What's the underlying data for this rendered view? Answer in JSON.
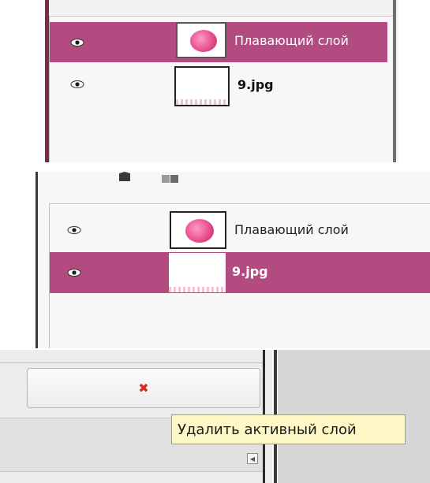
{
  "screens": [
    {
      "layers": [
        {
          "name": "Плавающий слой",
          "visible": true,
          "selected": true,
          "thumb": "floating-brain"
        },
        {
          "name": "9.jpg",
          "visible": true,
          "selected": false,
          "thumb": "white-image"
        }
      ]
    },
    {
      "layers": [
        {
          "name": "Плавающий слой",
          "visible": true,
          "selected": false,
          "thumb": "floating-brain"
        },
        {
          "name": "9.jpg",
          "visible": true,
          "selected": true,
          "thumb": "white-image"
        }
      ]
    }
  ],
  "delete_button": {
    "icon": "delete-x-icon",
    "symbol": "✖"
  },
  "tooltip": {
    "text": "Удалить активный слой"
  },
  "scroll": {
    "icon": "arrow-left-icon",
    "symbol": "◀"
  },
  "colors": {
    "selection": "#b24b7f",
    "tooltip_bg": "#fdf8c6",
    "delete_icon": "#d62b1e"
  }
}
